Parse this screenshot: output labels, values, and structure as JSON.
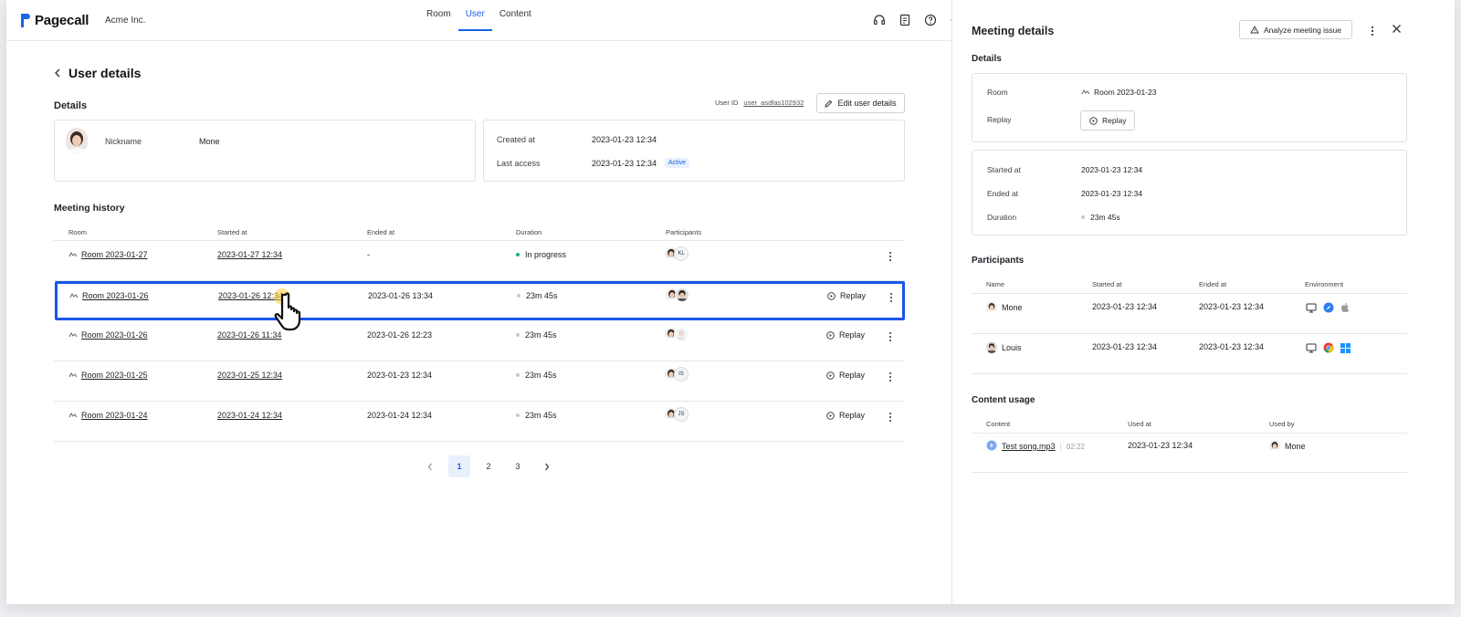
{
  "header": {
    "brand": "Pagecall",
    "org": "Acme Inc.",
    "tabs": [
      {
        "label": "Room",
        "active": false
      },
      {
        "label": "User",
        "active": true
      },
      {
        "label": "Content",
        "active": false
      }
    ],
    "icons": [
      "headset-icon",
      "document-icon",
      "help-icon",
      "settings-icon"
    ]
  },
  "page": {
    "title": "User details",
    "details_title": "Details",
    "user_id_label": "User ID",
    "user_id": "user_asdfas102932",
    "edit_label": "Edit user details",
    "nickname_label": "Nickname",
    "nickname": "Mone",
    "created_label": "Created at",
    "created": "2023-01-23 12:34",
    "last_access_label": "Last access",
    "last_access": "2023-01-23 12:34",
    "status_badge": "Active"
  },
  "history": {
    "title": "Meeting history",
    "columns": [
      "Room",
      "Started at",
      "Ended at",
      "Duration",
      "Participants"
    ],
    "rows": [
      {
        "room": "Room 2023-01-27",
        "started": "2023-01-27 12:34",
        "ended": "-",
        "duration": "In progress",
        "live": true,
        "initials": "KL",
        "replay": ""
      },
      {
        "room": "Room 2023-01-26",
        "started": "2023-01-26 12:34",
        "ended": "2023-01-26 13:34",
        "duration": "23m 45s",
        "live": false,
        "initials": "",
        "replay": "Replay"
      },
      {
        "room": "Room 2023-01-26",
        "started": "2023-01-26 11:34",
        "ended": "2023-01-26 12:23",
        "duration": "23m 45s",
        "live": false,
        "initials": "",
        "replay": "Replay"
      },
      {
        "room": "Room 2023-01-25",
        "started": "2023-01-25 12:34",
        "ended": "2023-01-23 12:34",
        "duration": "23m 45s",
        "live": false,
        "initials": "IS",
        "replay": "Replay"
      },
      {
        "room": "Room 2023-01-24",
        "started": "2023-01-24 12:34",
        "ended": "2023-01-24 12:34",
        "duration": "23m 45s",
        "live": false,
        "initials": "JS",
        "replay": "Replay"
      }
    ],
    "pages": [
      "1",
      "2",
      "3"
    ],
    "current_page": "1"
  },
  "panel": {
    "title": "Meeting details",
    "analyze_label": "Analyze meeting issue",
    "details_title": "Details",
    "room_label": "Room",
    "room": "Room 2023-01-23",
    "replay_label": "Replay",
    "replay_btn": "Replay",
    "started_label": "Started at",
    "started": "2023-01-23 12:34",
    "ended_label": "Ended at",
    "ended": "2023-01-23 12:34",
    "duration_label": "Duration",
    "duration": "23m 45s",
    "participants_title": "Participants",
    "participant_columns": [
      "Name",
      "Started at",
      "Ended at",
      "Environment"
    ],
    "participants": [
      {
        "name": "Mone",
        "started": "2023-01-23 12:34",
        "ended": "2023-01-23 12:34",
        "env": [
          "desktop-icon",
          "safari-icon",
          "apple-icon"
        ]
      },
      {
        "name": "Louis",
        "started": "2023-01-23 12:34",
        "ended": "2023-01-23 12:34",
        "env": [
          "desktop-icon",
          "chrome-icon",
          "windows-icon"
        ]
      }
    ],
    "content_title": "Content usage",
    "content_columns": [
      "Content",
      "Used at",
      "Used by"
    ],
    "content": [
      {
        "name": "Test song.mp3",
        "length": "02:22",
        "used_at": "2023-01-23 12:34",
        "used_by": "Mone"
      }
    ]
  },
  "colors": {
    "accent": "#1a64e8",
    "selection": "#1a55e8",
    "live": "#1bb36b"
  }
}
